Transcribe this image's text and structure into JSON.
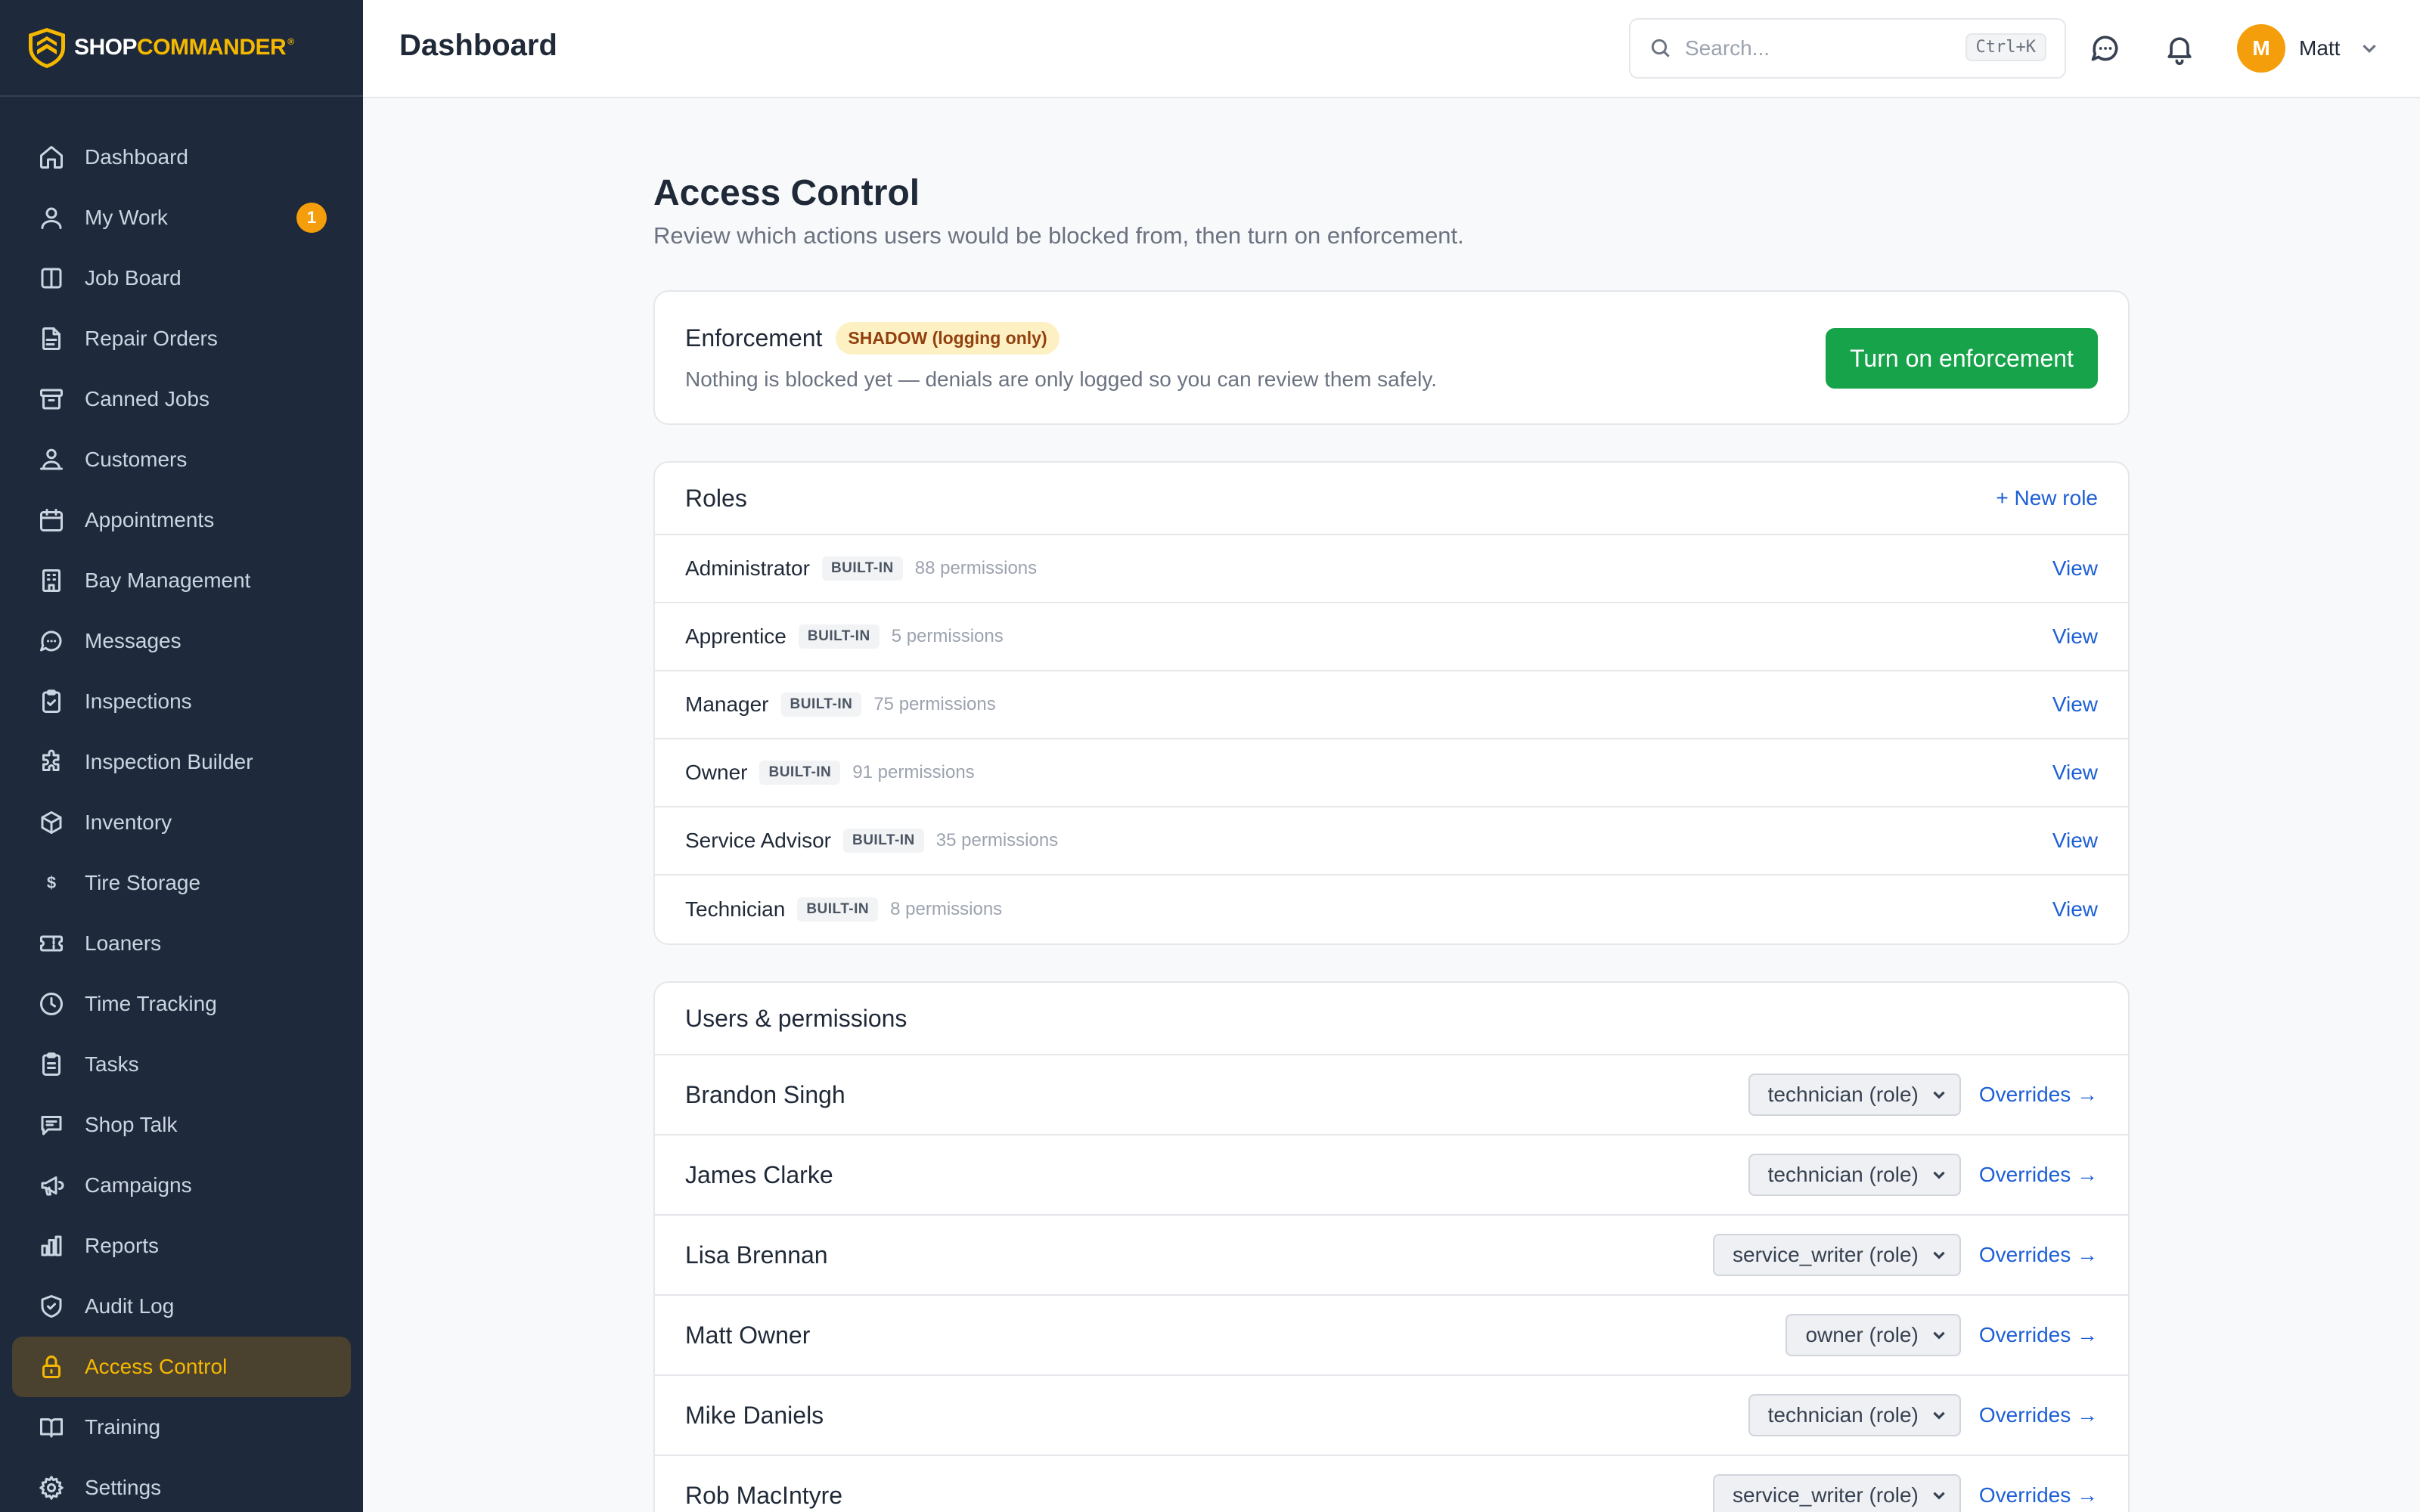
{
  "brand": {
    "part1": "SHOP",
    "part2": "COMMANDER",
    "reg": "®"
  },
  "sidebar": {
    "items": [
      {
        "label": "Dashboard",
        "icon": "home-icon"
      },
      {
        "label": "My Work",
        "icon": "user-icon",
        "badge": "1"
      },
      {
        "label": "Job Board",
        "icon": "columns-icon"
      },
      {
        "label": "Repair Orders",
        "icon": "file-icon"
      },
      {
        "label": "Canned Jobs",
        "icon": "archive-icon"
      },
      {
        "label": "Customers",
        "icon": "customers-icon"
      },
      {
        "label": "Appointments",
        "icon": "calendar-icon"
      },
      {
        "label": "Bay Management",
        "icon": "building-icon"
      },
      {
        "label": "Messages",
        "icon": "chat-icon"
      },
      {
        "label": "Inspections",
        "icon": "clipboard-check-icon"
      },
      {
        "label": "Inspection Builder",
        "icon": "puzzle-icon"
      },
      {
        "label": "Inventory",
        "icon": "box-icon"
      },
      {
        "label": "Tire Storage",
        "icon": "dollar-icon"
      },
      {
        "label": "Loaners",
        "icon": "ticket-icon"
      },
      {
        "label": "Time Tracking",
        "icon": "clock-icon"
      },
      {
        "label": "Tasks",
        "icon": "clipboard-list-icon"
      },
      {
        "label": "Shop Talk",
        "icon": "message-square-icon"
      },
      {
        "label": "Campaigns",
        "icon": "megaphone-icon"
      },
      {
        "label": "Reports",
        "icon": "bar-chart-icon"
      },
      {
        "label": "Audit Log",
        "icon": "shield-check-icon"
      },
      {
        "label": "Access Control",
        "icon": "lock-icon",
        "active": true
      },
      {
        "label": "Training",
        "icon": "book-icon"
      },
      {
        "label": "Settings",
        "icon": "gear-icon"
      }
    ]
  },
  "topbar": {
    "title": "Dashboard",
    "search_placeholder": "Search...",
    "search_shortcut": "Ctrl+K",
    "user_initial": "M",
    "user_name": "Matt"
  },
  "main": {
    "title": "Access Control",
    "subtitle": "Review which actions users would be blocked from, then turn on enforcement.",
    "enforcement": {
      "title": "Enforcement",
      "badge": "SHADOW (logging only)",
      "description": "Nothing is blocked yet — denials are only logged so you can review them safely.",
      "button": "Turn on enforcement"
    },
    "roles": {
      "title": "Roles",
      "new_role": "+ New role",
      "tag": "BUILT-IN",
      "view": "View",
      "items": [
        {
          "name": "Administrator",
          "permissions": "88 permissions"
        },
        {
          "name": "Apprentice",
          "permissions": "5 permissions"
        },
        {
          "name": "Manager",
          "permissions": "75 permissions"
        },
        {
          "name": "Owner",
          "permissions": "91 permissions"
        },
        {
          "name": "Service Advisor",
          "permissions": "35 permissions"
        },
        {
          "name": "Technician",
          "permissions": "8 permissions"
        }
      ]
    },
    "users": {
      "title": "Users & permissions",
      "overrides": "Overrides →",
      "items": [
        {
          "name": "Brandon Singh",
          "role": "technician (role)"
        },
        {
          "name": "James Clarke",
          "role": "technician (role)"
        },
        {
          "name": "Lisa Brennan",
          "role": "service_writer (role)"
        },
        {
          "name": "Matt Owner",
          "role": "owner (role)"
        },
        {
          "name": "Mike Daniels",
          "role": "technician (role)"
        },
        {
          "name": "Rob MacIntyre",
          "role": "service_writer (role)"
        }
      ]
    }
  },
  "colors": {
    "sidebar_bg": "#1e293b",
    "accent": "#f5b800",
    "primary_button": "#16a34a",
    "link": "#1d5fd6",
    "avatar": "#f59e0b"
  }
}
